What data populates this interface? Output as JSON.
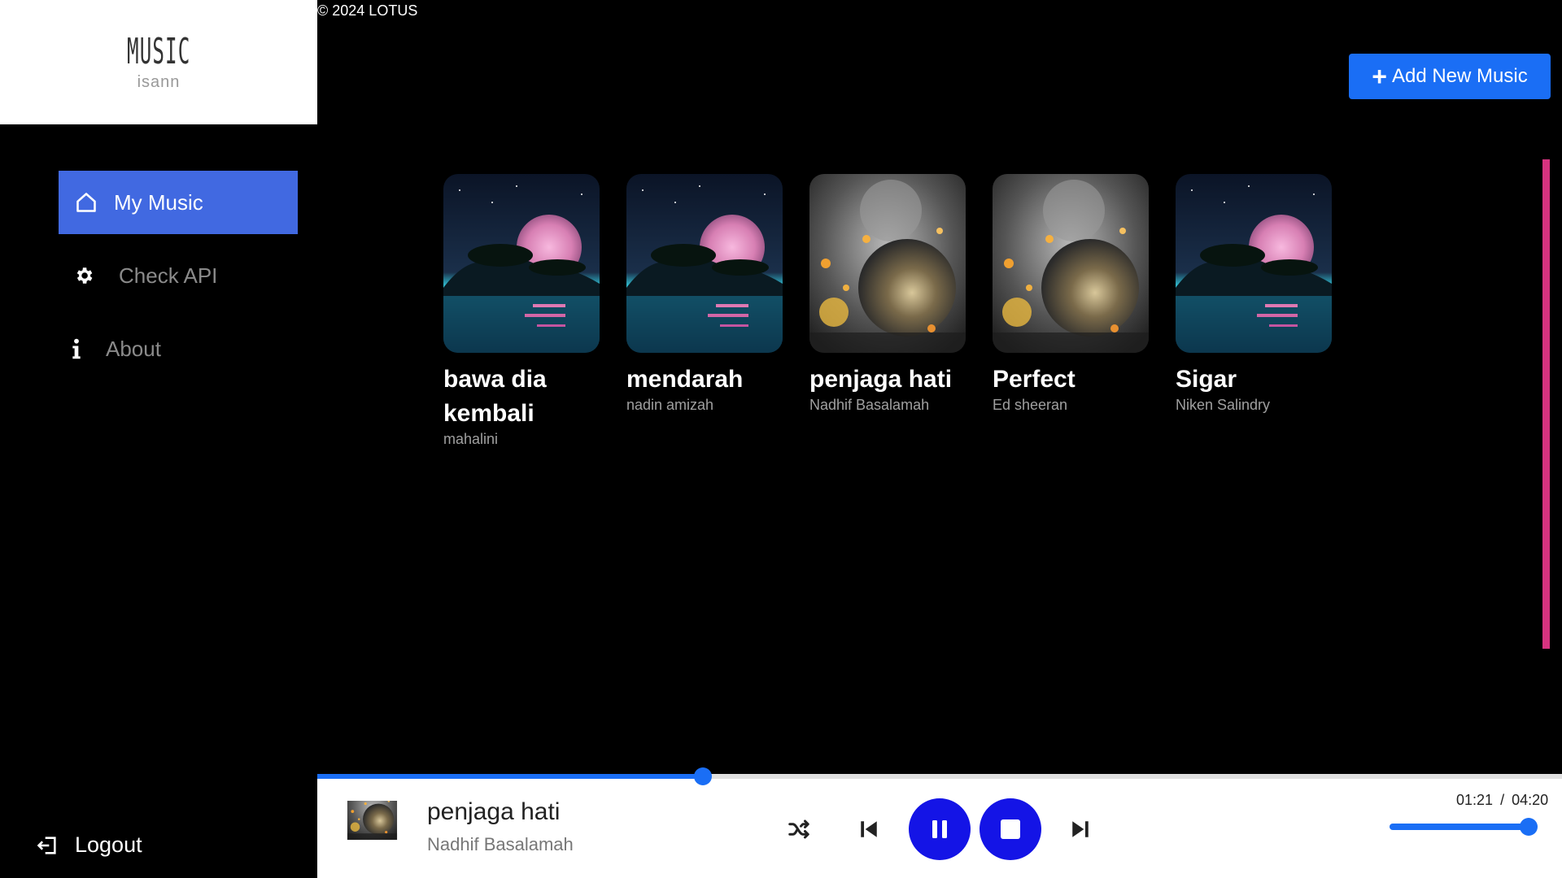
{
  "logo": {
    "title": "MUSIC",
    "subtitle": "isann"
  },
  "copyright": "© 2024 LOTUS",
  "nav": {
    "items": [
      {
        "label": "My Music",
        "icon": "home-icon",
        "active": true
      },
      {
        "label": "Check API",
        "icon": "gear-icon",
        "active": false
      },
      {
        "label": "About",
        "icon": "info-icon",
        "active": false
      }
    ],
    "logout": "Logout"
  },
  "add_button": {
    "label": "Add New Music",
    "icon": "plus-icon"
  },
  "songs": [
    {
      "title": "bawa dia kembali",
      "artist": "mahalini",
      "cover": "moon-island"
    },
    {
      "title": "mendarah",
      "artist": "nadin amizah",
      "cover": "moon-island"
    },
    {
      "title": "penjaga hati",
      "artist": "Nadhif Basalamah",
      "cover": "glass-lightbulb"
    },
    {
      "title": "Perfect",
      "artist": "Ed sheeran",
      "cover": "glass-lightbulb"
    },
    {
      "title": "Sigar",
      "artist": "Niken Salindry",
      "cover": "moon-island"
    }
  ],
  "player": {
    "title": "penjaga hati",
    "artist": "Nadhif Basalamah",
    "current_time": "01:21",
    "separator": "/",
    "total_time": "04:20",
    "progress": 0.31,
    "volume": 0.95,
    "controls": [
      "shuffle-icon",
      "previous-icon",
      "pause-icon",
      "stop-icon",
      "next-icon"
    ]
  },
  "colors": {
    "accent": "#1a6ef5",
    "nav_active": "#4169e1",
    "control": "#1414e6",
    "scrollbar": "#d6337f"
  }
}
